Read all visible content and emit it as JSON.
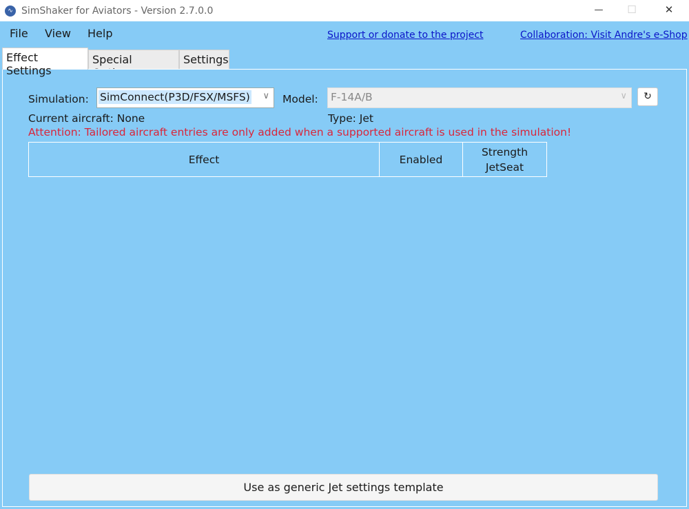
{
  "window": {
    "title": "SimShaker for Aviators  - Version 2.7.0.0",
    "minimize": "—",
    "maximize": "☐",
    "close": "✕"
  },
  "menu": [
    "File",
    "View",
    "Help"
  ],
  "links": {
    "support": "Support or donate to the project",
    "collab": "Collaboration: Visit Andre's e-Shop"
  },
  "tabs": [
    "Effect Settings",
    "Special Options",
    "Settings"
  ],
  "form": {
    "simulation_label": "Simulation:",
    "simulation_value": "SimConnect(P3D/FSX/MSFS)",
    "model_label": "Model:",
    "model_value": "F-14A/B",
    "refresh": "↻",
    "current_aircraft": "Current aircraft: None",
    "type": "Type: Jet",
    "attention": "Attention: Tailored aircraft entries are only added when a supported aircraft is used in the simulation!"
  },
  "table": {
    "headers": [
      "Effect",
      "Enabled",
      "Strength JetSeat"
    ]
  },
  "bottom_button": "Use as generic Jet settings template",
  "colors": {
    "background": "#86cbf6",
    "attention": "#d9263b",
    "link": "#0a14c8"
  }
}
